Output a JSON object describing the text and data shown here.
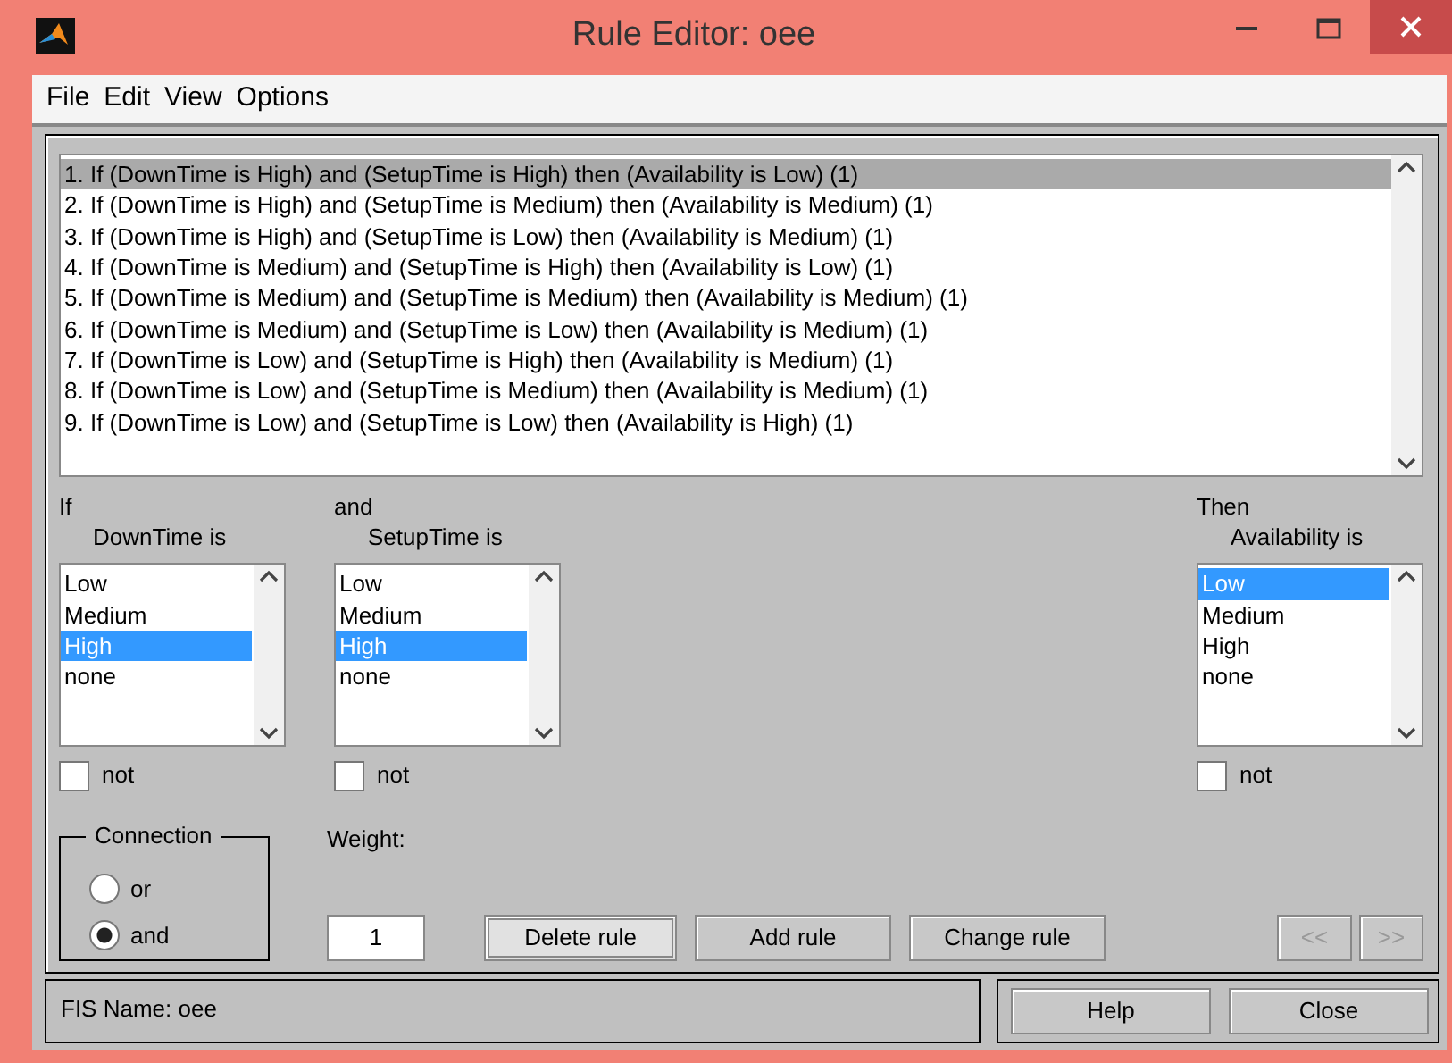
{
  "window": {
    "title": "Rule Editor: oee"
  },
  "menu": [
    "File",
    "Edit",
    "View",
    "Options"
  ],
  "rules": [
    {
      "text": "1. If (DownTime is High) and (SetupTime is High) then (Availability is Low) (1)",
      "selected": true
    },
    {
      "text": "2. If (DownTime is High) and (SetupTime is Medium) then (Availability is Medium) (1)",
      "selected": false
    },
    {
      "text": "3. If (DownTime is High) and (SetupTime is Low) then (Availability is Medium) (1)",
      "selected": false
    },
    {
      "text": "4. If (DownTime is Medium) and (SetupTime is High) then (Availability is Low) (1)",
      "selected": false
    },
    {
      "text": "5. If (DownTime is Medium) and (SetupTime is Medium) then (Availability is Medium) (1)",
      "selected": false
    },
    {
      "text": "6. If (DownTime is Medium) and (SetupTime is Low) then (Availability is Medium) (1)",
      "selected": false
    },
    {
      "text": "7. If (DownTime is Low) and (SetupTime is High) then (Availability is Medium) (1)",
      "selected": false
    },
    {
      "text": "8. If (DownTime is Low) and (SetupTime is Medium) then (Availability is Medium) (1)",
      "selected": false
    },
    {
      "text": "9. If (DownTime is Low) and (SetupTime is Low) then (Availability is High) (1)",
      "selected": false
    }
  ],
  "variables": [
    {
      "kind": "input",
      "keyword": "If",
      "name": "DownTime is",
      "not_label": "not",
      "not": false,
      "options": [
        {
          "label": "Low",
          "selected": false
        },
        {
          "label": "Medium",
          "selected": false
        },
        {
          "label": "High",
          "selected": true
        },
        {
          "label": "none",
          "selected": false
        }
      ]
    },
    {
      "kind": "input",
      "keyword": "and",
      "name": "SetupTime is",
      "not_label": "not",
      "not": false,
      "options": [
        {
          "label": "Low",
          "selected": false
        },
        {
          "label": "Medium",
          "selected": false
        },
        {
          "label": "High",
          "selected": true
        },
        {
          "label": "none",
          "selected": false
        }
      ]
    },
    {
      "kind": "output",
      "keyword": "Then",
      "name": "Availability is",
      "not_label": "not",
      "not": false,
      "options": [
        {
          "label": "Low",
          "selected": true
        },
        {
          "label": "Medium",
          "selected": false
        },
        {
          "label": "High",
          "selected": false
        },
        {
          "label": "none",
          "selected": false
        }
      ]
    }
  ],
  "connection": {
    "title": "Connection",
    "options": [
      {
        "label": "or",
        "selected": false
      },
      {
        "label": "and",
        "selected": true
      }
    ]
  },
  "weight": {
    "label": "Weight:",
    "value": "1"
  },
  "rule_buttons": [
    {
      "label": "Delete rule",
      "focused": true
    },
    {
      "label": "Add rule",
      "focused": false
    },
    {
      "label": "Change rule",
      "focused": false
    }
  ],
  "nav_buttons": [
    {
      "label": "<<",
      "disabled": true
    },
    {
      "label": ">>",
      "disabled": true
    }
  ],
  "status": "FIS Name: oee",
  "footer_buttons": [
    "Help",
    "Close"
  ]
}
